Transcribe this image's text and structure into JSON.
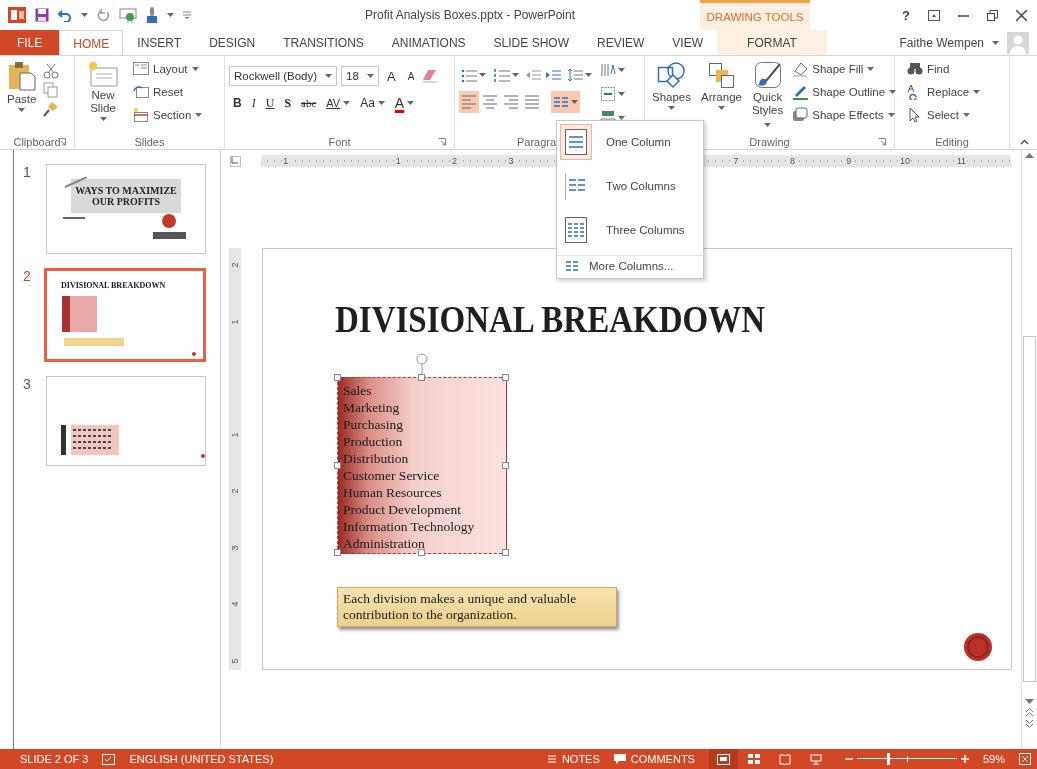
{
  "window": {
    "title": "Profit Analysis Boxes.pptx - PowerPoint",
    "context_header": "DRAWING TOOLS",
    "help": "?"
  },
  "tabs": [
    {
      "label": "FILE",
      "kind": "file",
      "selected": false
    },
    {
      "label": "HOME",
      "kind": "tab",
      "selected": true
    },
    {
      "label": "INSERT",
      "kind": "tab",
      "selected": false
    },
    {
      "label": "DESIGN",
      "kind": "tab",
      "selected": false
    },
    {
      "label": "TRANSITIONS",
      "kind": "tab",
      "selected": false
    },
    {
      "label": "ANIMATIONS",
      "kind": "tab",
      "selected": false
    },
    {
      "label": "SLIDE SHOW",
      "kind": "tab",
      "selected": false
    },
    {
      "label": "REVIEW",
      "kind": "tab",
      "selected": false
    },
    {
      "label": "VIEW",
      "kind": "tab",
      "selected": false
    },
    {
      "label": "FORMAT",
      "kind": "context",
      "selected": false
    }
  ],
  "user": {
    "name": "Faithe Wempen"
  },
  "ribbon": {
    "clipboard": {
      "label": "Clipboard",
      "paste": "Paste"
    },
    "slides": {
      "label": "Slides",
      "new_slide": "New Slide",
      "items": [
        "Layout",
        "Reset",
        "Section"
      ]
    },
    "font": {
      "label": "Font",
      "font_name": "Rockwell (Body)",
      "font_size": "18",
      "grow": "A",
      "shrink": "A",
      "buttons": [
        {
          "label": "B",
          "kind": "bold"
        },
        {
          "label": "I",
          "kind": "italic"
        },
        {
          "label": "U",
          "kind": "underline"
        },
        {
          "label": "S",
          "kind": "shadow"
        },
        {
          "label": "abc",
          "kind": "strike"
        },
        {
          "label": "AV",
          "kind": "spacing"
        },
        {
          "label": "Aa",
          "kind": "case"
        },
        {
          "label": "A",
          "kind": "color"
        }
      ]
    },
    "paragraph": {
      "label": "Paragra",
      "alignments": [
        {
          "kind": "left",
          "selected": true
        },
        {
          "kind": "center",
          "selected": false
        },
        {
          "kind": "right",
          "selected": false
        },
        {
          "kind": "justify",
          "selected": false
        }
      ],
      "columns_open": true
    },
    "drawing": {
      "label": "Drawing",
      "shapes": "Shapes",
      "arrange": "Arrange",
      "quick_styles": "Quick Styles",
      "items": [
        "Shape Fill",
        "Shape Outline",
        "Shape Effects"
      ]
    },
    "editing": {
      "label": "Editing",
      "items": [
        "Find",
        "Replace",
        "Select"
      ]
    }
  },
  "columns_menu": {
    "items": [
      {
        "label": "One Column",
        "kind": "one",
        "selected": true
      },
      {
        "label": "Two Columns",
        "kind": "two",
        "selected": false
      },
      {
        "label": "Three Columns",
        "kind": "three",
        "selected": false
      }
    ],
    "more": "More Columns..."
  },
  "slides_pane": [
    {
      "number": "1",
      "kind": "title",
      "selected": false,
      "title": "WAYS TO MAXIMIZE OUR PROFITS"
    },
    {
      "number": "2",
      "kind": "list",
      "selected": true,
      "title": "DIVISIONAL BREAKDOWN"
    },
    {
      "number": "3",
      "kind": "sections",
      "selected": false
    }
  ],
  "horizontal_ruler": [
    "1",
    "1",
    "2",
    "3",
    "7",
    "8",
    "9",
    "10",
    "11"
  ],
  "vertical_ruler": [
    "2",
    "1",
    "1",
    "2",
    "3",
    "4",
    "5"
  ],
  "slide": {
    "title": "DIVISIONAL BREAKDOWN",
    "list": [
      "Sales",
      "Marketing",
      "Purchasing",
      "Production",
      "Distribution",
      "Customer Service",
      "Human Resources",
      "Product Development",
      "Information Technology",
      "Administration"
    ],
    "caption": "Each division makes a unique and valuable contribution to the organization."
  },
  "status_bar": {
    "slide": "SLIDE 2 OF 3",
    "language": "ENGLISH (UNITED STATES)",
    "notes": "NOTES",
    "comments": "COMMENTS",
    "views": [
      {
        "kind": "normal",
        "selected": true
      },
      {
        "kind": "sorter",
        "selected": false
      },
      {
        "kind": "reading",
        "selected": false
      },
      {
        "kind": "show",
        "selected": false
      }
    ],
    "zoom": {
      "level": 0.31,
      "reading": "59%"
    }
  }
}
